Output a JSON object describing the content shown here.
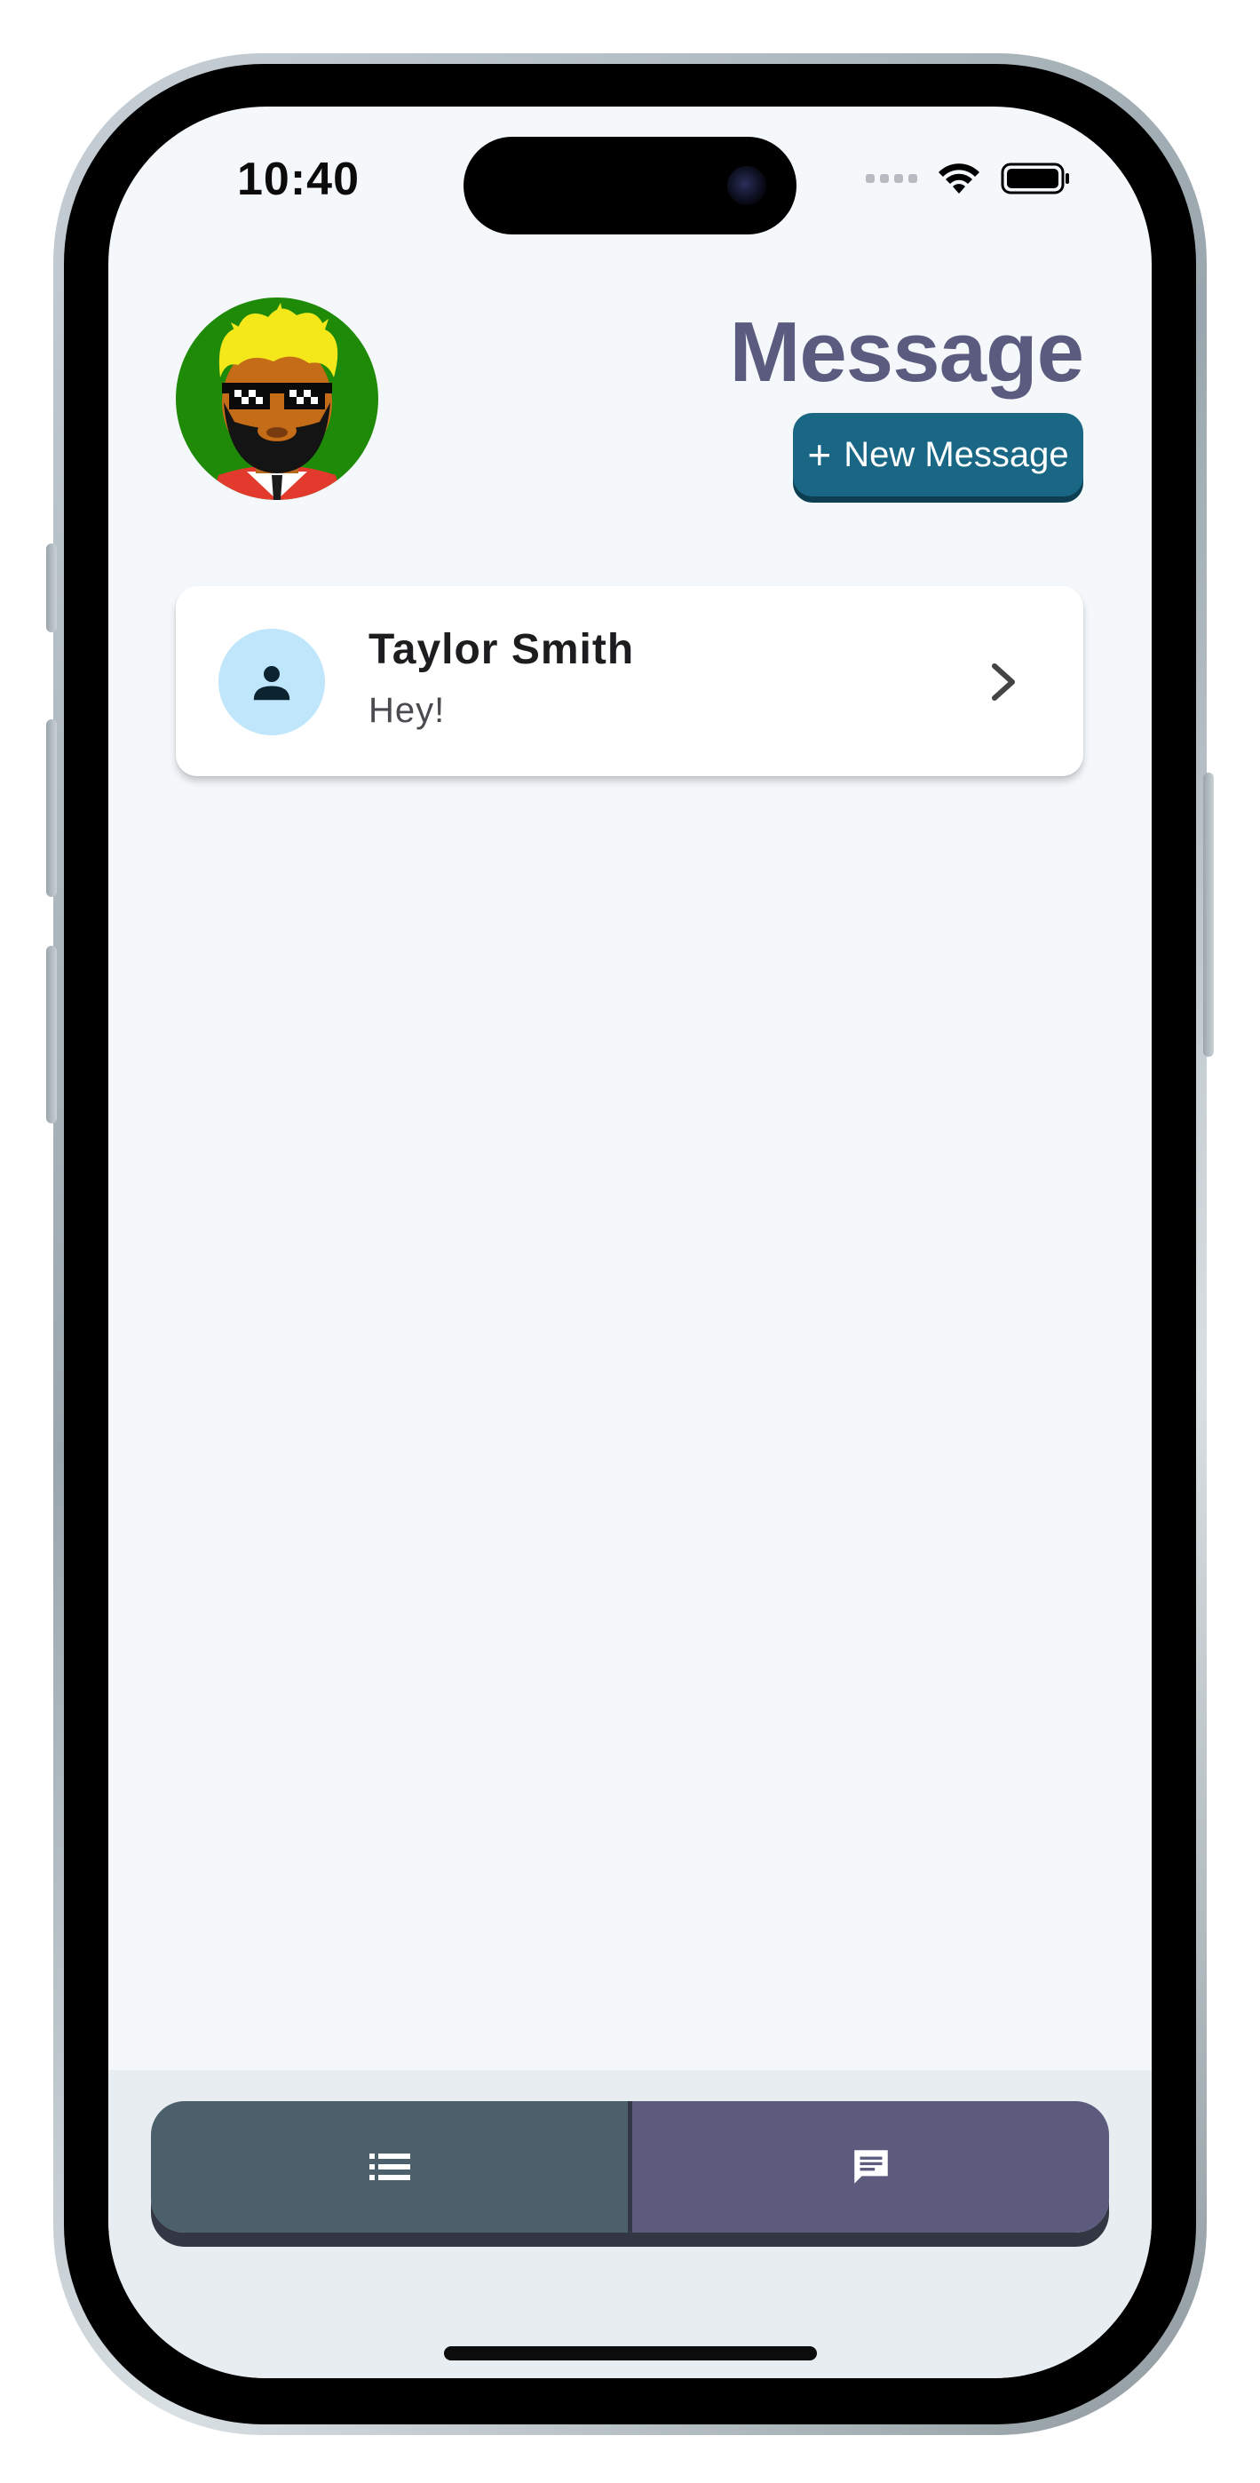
{
  "status_bar": {
    "time": "10:40",
    "icons": [
      "signal-dots-icon",
      "wifi-icon",
      "battery-icon"
    ]
  },
  "header": {
    "title": "Message",
    "new_message_label": "New Message",
    "new_message_icon": "plus-icon",
    "user_avatar": "pixel-sunglasses-avatar"
  },
  "conversations": [
    {
      "name": "Taylor Smith",
      "preview": "Hey!",
      "avatar_icon": "person-icon",
      "action_icon": "chevron-right-icon"
    }
  ],
  "tab_bar": {
    "tabs": [
      {
        "id": "list",
        "icon": "list-icon",
        "active": false
      },
      {
        "id": "messages",
        "icon": "chat-icon",
        "active": true
      }
    ]
  },
  "colors": {
    "background": "#f4f8fb",
    "title": "#5b5a7f",
    "primary_button": "#1a6785",
    "tab_list": "#4c606b",
    "tab_messages": "#5c5b7e",
    "contact_avatar_bg": "#bfe6fb"
  }
}
